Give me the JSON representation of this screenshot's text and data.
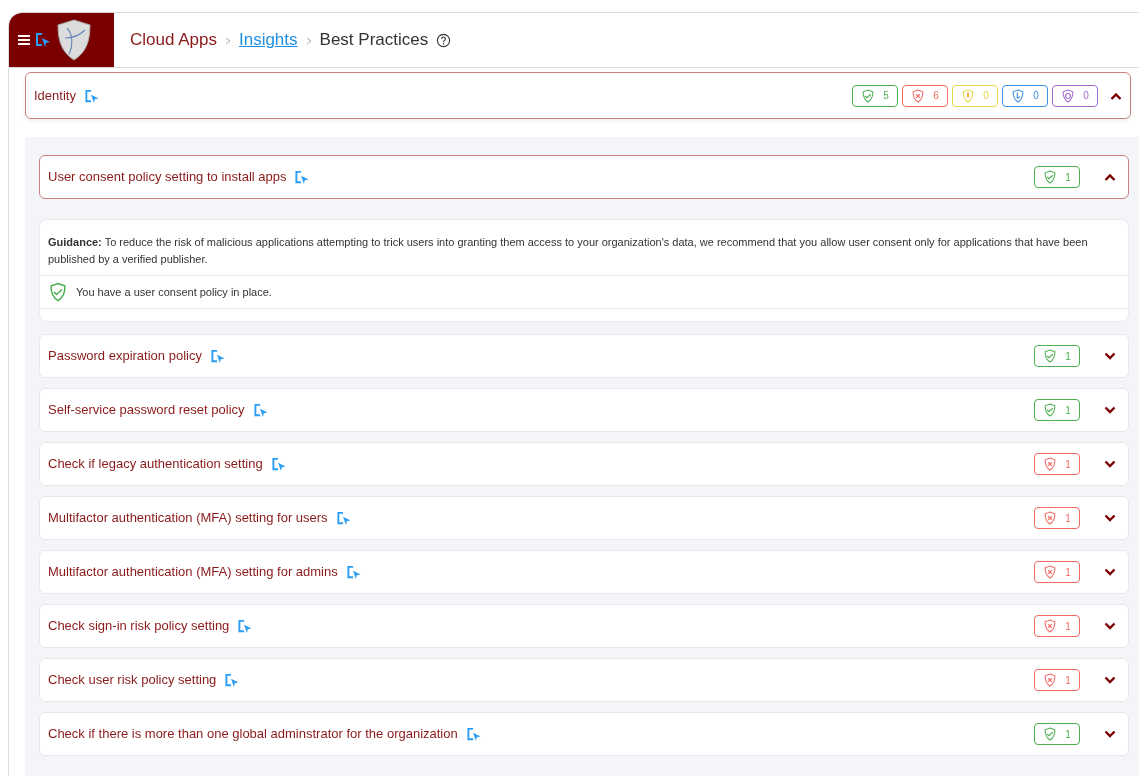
{
  "breadcrumb": [
    {
      "label": "Cloud Apps",
      "kind": "root"
    },
    {
      "label": "Insights",
      "kind": "link"
    },
    {
      "label": "Best Practices",
      "kind": "current"
    }
  ],
  "section": {
    "title": "Identity",
    "expanded": true,
    "badges": [
      {
        "kind": "pass",
        "count": "5"
      },
      {
        "kind": "fail",
        "count": "6"
      },
      {
        "kind": "warn",
        "count": "0"
      },
      {
        "kind": "info",
        "count": "0"
      },
      {
        "kind": "other",
        "count": "0"
      }
    ]
  },
  "items": [
    {
      "title": "User consent policy setting to install apps",
      "badge": {
        "kind": "pass",
        "count": "1"
      },
      "expanded": true,
      "guidance_label": "Guidance:",
      "guidance": "To reduce the risk of malicious applications attempting to trick users into granting them access to your organization's data, we recommend that you allow user consent only for applications that have been published by a verified publisher.",
      "result": {
        "kind": "pass",
        "text": "You have a user consent policy in place."
      }
    },
    {
      "title": "Password expiration policy",
      "badge": {
        "kind": "pass",
        "count": "1"
      },
      "expanded": false
    },
    {
      "title": "Self-service password reset policy",
      "badge": {
        "kind": "pass",
        "count": "1"
      },
      "expanded": false
    },
    {
      "title": "Check if legacy authentication setting",
      "badge": {
        "kind": "fail",
        "count": "1"
      },
      "expanded": false
    },
    {
      "title": "Multifactor authentication (MFA) setting for users",
      "badge": {
        "kind": "fail",
        "count": "1"
      },
      "expanded": false
    },
    {
      "title": "Multifactor authentication (MFA) setting for admins",
      "badge": {
        "kind": "fail",
        "count": "1"
      },
      "expanded": false
    },
    {
      "title": "Check sign-in risk policy setting",
      "badge": {
        "kind": "fail",
        "count": "1"
      },
      "expanded": false
    },
    {
      "title": "Check user risk policy setting",
      "badge": {
        "kind": "fail",
        "count": "1"
      },
      "expanded": false
    },
    {
      "title": "Check if there is more than one global adminstrator for the organization",
      "badge": {
        "kind": "pass",
        "count": "1"
      },
      "expanded": false
    }
  ]
}
